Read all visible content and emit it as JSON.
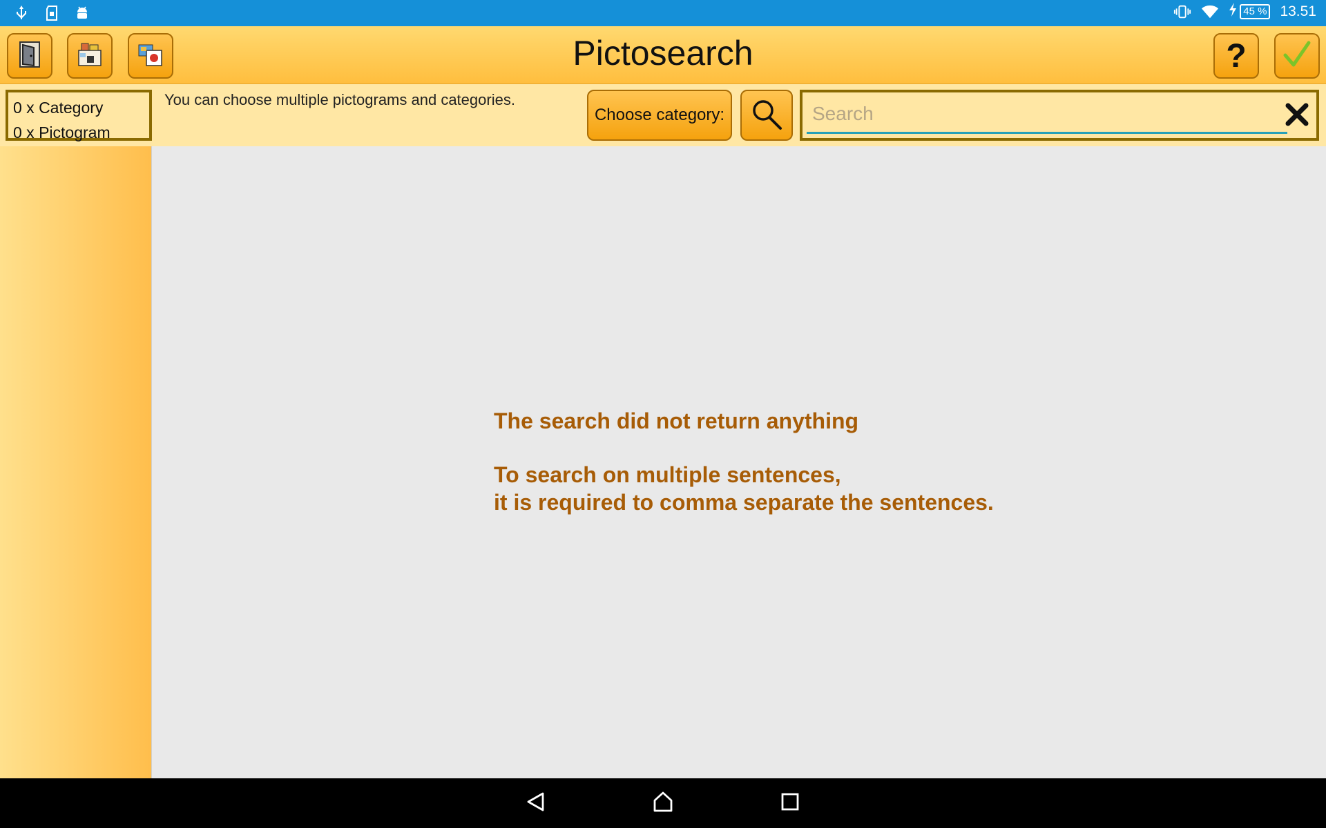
{
  "status_bar": {
    "time": "13.51",
    "battery": "45 %",
    "left_icons": [
      "usb-icon",
      "sd-card-icon",
      "android-icon"
    ],
    "right_icons": [
      "vibrate-icon",
      "wifi-icon",
      "charging-icon"
    ]
  },
  "header": {
    "title": "Pictosearch",
    "left_buttons": [
      "door-exit-icon",
      "category-picture-icon",
      "photo-camera-icon"
    ],
    "right_buttons": [
      "help-icon",
      "check-icon"
    ],
    "help_label": "?",
    "confirm_label": "✓",
    "colors": {
      "accent": "#ffbe3e",
      "border": "#a96d06",
      "check": "#7bc42a"
    }
  },
  "toolbar": {
    "category_count": "0 x Category",
    "pictogram_count": "0 x Pictogram",
    "hint": "You can choose multiple pictograms and categories.",
    "choose_category_label": "Choose category:",
    "search_placeholder": "Search",
    "search_value": ""
  },
  "main": {
    "empty_title": "The search did not return anything",
    "empty_line1": "To search on multiple sentences,",
    "empty_line2": "it is required to comma separate the sentences.",
    "text_color": "#a75c06"
  },
  "nav_bar": {
    "buttons": [
      "back-icon",
      "home-icon",
      "recents-icon"
    ]
  }
}
